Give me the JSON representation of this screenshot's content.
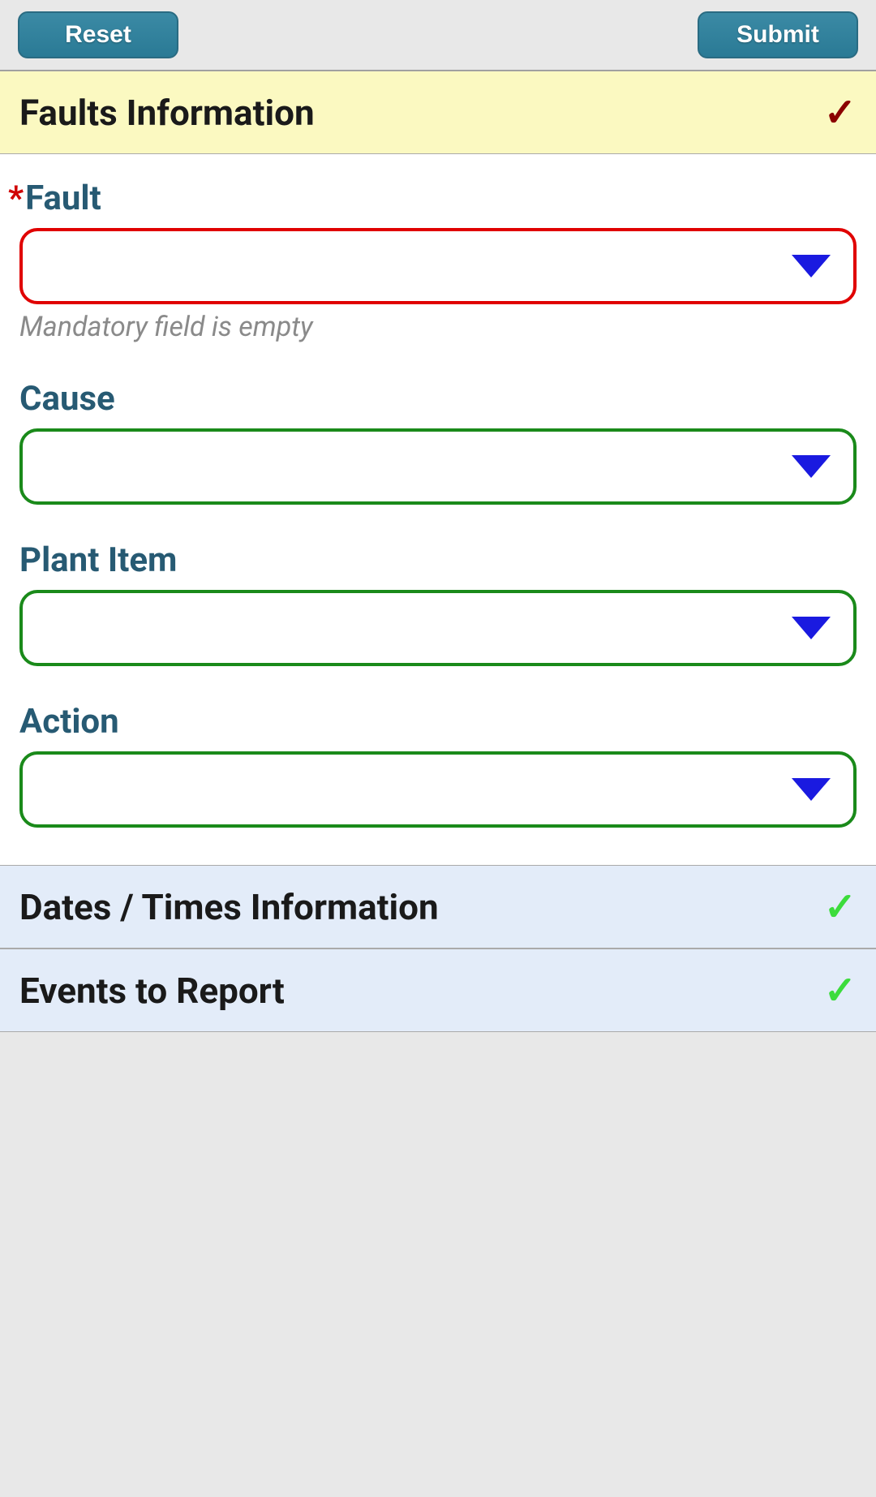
{
  "toolbar": {
    "reset_label": "Reset",
    "submit_label": "Submit"
  },
  "sections": {
    "faults": {
      "title": "Faults Information",
      "status": "error"
    },
    "dates": {
      "title": "Dates / Times Information",
      "status": "valid"
    },
    "events": {
      "title": "Events to Report",
      "status": "valid"
    }
  },
  "fields": {
    "fault": {
      "label": "Fault",
      "required": true,
      "value": "",
      "error_message": "Mandatory field is empty"
    },
    "cause": {
      "label": "Cause",
      "required": false,
      "value": ""
    },
    "plant_item": {
      "label": "Plant Item",
      "required": false,
      "value": ""
    },
    "action": {
      "label": "Action",
      "required": false,
      "value": ""
    }
  }
}
